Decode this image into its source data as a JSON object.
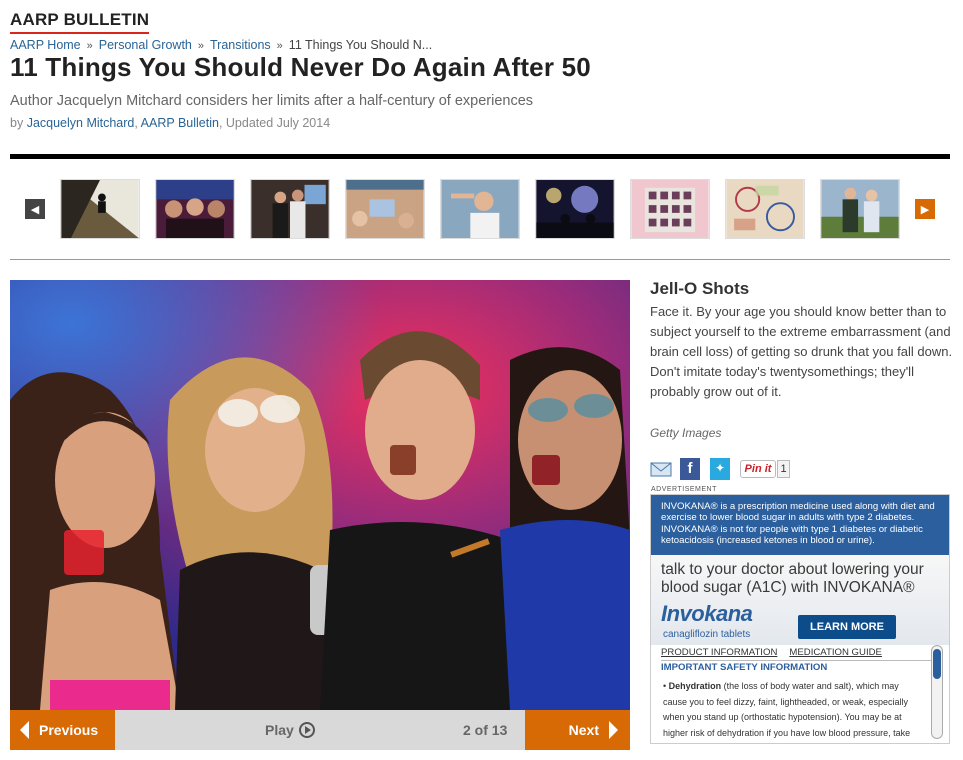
{
  "masthead": {
    "logo": "AARP BULLETIN"
  },
  "breadcrumb": {
    "items": [
      "AARP Home",
      "Personal Growth",
      "Transitions"
    ],
    "separator": "»",
    "current": "11 Things You Should N..."
  },
  "article": {
    "title": "11 Things You Should Never Do Again After 50",
    "subtitle": "Author Jacquelyn Mitchard considers her limits after a half-century of experiences",
    "byline_prefix": "by",
    "author": "Jacquelyn Mitchard",
    "publication": "AARP Bulletin",
    "updated": "Updated July 2014"
  },
  "thumbnails": {
    "count": 9
  },
  "slide": {
    "heading": "Jell-O Shots",
    "caption": "Face it. By your age you should know better than to subject yourself to the extreme embarrassment (and brain cell loss) of getting so drunk that you fall down. Don't imitate today's twentysomethings; they'll probably grow out of it.",
    "credit": "Getty Images"
  },
  "slide_nav": {
    "previous": "Previous",
    "play": "Play",
    "counter": "2 of 13",
    "next": "Next"
  },
  "share": {
    "pinit": "Pin it",
    "pin_count": "1"
  },
  "ad": {
    "label": "ADVERTISEMENT",
    "top_text": "INVOKANA® is a prescription medicine used along with diet and exercise to lower blood sugar in adults with type 2 diabetes. INVOKANA® is not for people with type 1 diabetes or diabetic ketoacidosis (increased ketones in blood or urine).",
    "headline": "talk to your doctor about lowering your blood sugar (A1C) with INVOKANA®",
    "brand": "Invokana",
    "generic": "canagliflozin tablets",
    "cta": "LEARN MORE",
    "link1": "PRODUCT INFORMATION",
    "link2": "MEDICATION GUIDE",
    "safety_title": "IMPORTANT SAFETY INFORMATION",
    "body_bold": "Dehydration",
    "body": " (the loss of body water and salt), which may cause you to feel dizzy, faint, lightheaded, or weak, especially when you stand up (orthostatic hypotension). You may be at higher risk of dehydration if you have low blood pressure, take medicines to lower your blood pressure (including diuretics"
  },
  "colors": {
    "accent_orange": "#d86a06",
    "link_blue": "#2a6496",
    "ad_blue": "#2b5f9e",
    "masthead_red": "#d9261c"
  }
}
